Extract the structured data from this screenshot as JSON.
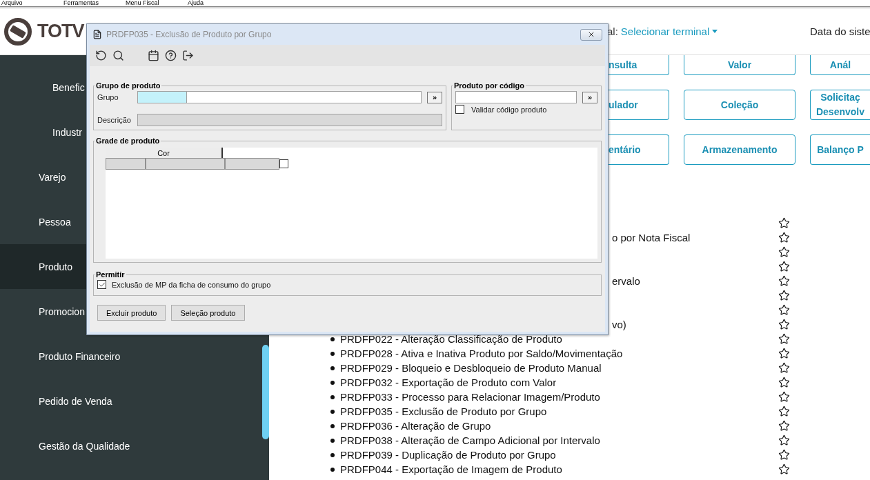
{
  "menu_bar": [
    "Arquivo",
    "Ferramentas",
    "Menu Fiscal",
    "Ajuda"
  ],
  "header": {
    "logo": "TOTV",
    "terminal_label": "al:",
    "terminal_value": "Selecionar terminal",
    "date_label": "Data do siste"
  },
  "sidebar": {
    "items": [
      {
        "label": "Benefic",
        "kind": "subitem",
        "selected": false
      },
      {
        "label": "Industr",
        "kind": "subitem",
        "selected": false
      },
      {
        "label": "Varejo",
        "kind": "item",
        "selected": false
      },
      {
        "label": "Pessoa",
        "kind": "item",
        "selected": false
      },
      {
        "label": "Produto",
        "kind": "item",
        "selected": true
      },
      {
        "label": "Promocion",
        "kind": "item",
        "selected": false
      },
      {
        "label": "Produto Financeiro",
        "kind": "item",
        "selected": false
      },
      {
        "label": "Pedido de Venda",
        "kind": "item",
        "selected": false
      },
      {
        "label": "Gestão da Qualidade",
        "kind": "item",
        "selected": false
      }
    ]
  },
  "tiles": [
    {
      "lines": [
        "nsulta"
      ],
      "kind": "cut-left"
    },
    {
      "lines": [
        "ulador"
      ],
      "kind": "cut-left"
    },
    {
      "lines": [
        "entário"
      ],
      "kind": "cut-left"
    },
    {
      "lines": [
        "Valor"
      ],
      "kind": "full"
    },
    {
      "lines": [
        "Coleção"
      ],
      "kind": "full"
    },
    {
      "lines": [
        "Armazenamento"
      ],
      "kind": "full"
    },
    {
      "lines": [
        "Anál"
      ],
      "kind": "cut-right"
    },
    {
      "lines": [
        "Solicitaç",
        "Desenvolv"
      ],
      "kind": "cut-right"
    },
    {
      "lines": [
        "Balanço P"
      ],
      "kind": "cut-right"
    }
  ],
  "programs": [
    {
      "kind": "hidden"
    },
    {
      "kind": "partial",
      "text": "o por Nota Fiscal"
    },
    {
      "kind": "hidden"
    },
    {
      "kind": "hidden"
    },
    {
      "kind": "partial",
      "text": "ervalo"
    },
    {
      "kind": "hidden"
    },
    {
      "kind": "hidden"
    },
    {
      "kind": "partial",
      "text": "vo)"
    },
    {
      "kind": "full",
      "text": "PRDFP022 - Alteração Classificação de Produto"
    },
    {
      "kind": "full",
      "text": "PRDFP028 - Ativa e Inativa Produto por Saldo/Movimentação"
    },
    {
      "kind": "full",
      "text": "PRDFP029 - Bloqueio e Desbloqueio de Produto Manual"
    },
    {
      "kind": "full",
      "text": "PRDFP032 - Exportação de Produto com Valor"
    },
    {
      "kind": "full",
      "text": "PRDFP033 - Processo para Relacionar Imagem/Produto"
    },
    {
      "kind": "full",
      "text": "PRDFP035 - Exclusão de Produto por Grupo"
    },
    {
      "kind": "full",
      "text": "PRDFP036 - Alteração de Grupo"
    },
    {
      "kind": "full",
      "text": "PRDFP038 - Alteração de Campo Adicional por Intervalo"
    },
    {
      "kind": "full",
      "text": "PRDFP039 - Duplicação de Produto por Grupo"
    },
    {
      "kind": "full",
      "text": "PRDFP044 - Exportação de Imagem de Produto"
    }
  ],
  "dialog": {
    "title": "PRDFP035 - Exclusão de Produto por Grupo",
    "grupo_de_produto": {
      "legend": "Grupo de produto",
      "grupo_label": "Grupo",
      "lookup_button": "»",
      "descricao_label": "Descrição"
    },
    "produto_por_codigo": {
      "legend": "Produto por código",
      "lookup_button": "»",
      "validate_label": "Validar código produto",
      "validate_checked": false
    },
    "grade": {
      "legend": "Grade de produto",
      "header": "Cor",
      "row_checked": false
    },
    "permitir": {
      "legend": "Permitir",
      "option_label": "Exclusão de MP da ficha de consumo do grupo",
      "option_checked": true
    },
    "buttons": [
      "Excluir produto",
      "Seleção produto"
    ]
  }
}
